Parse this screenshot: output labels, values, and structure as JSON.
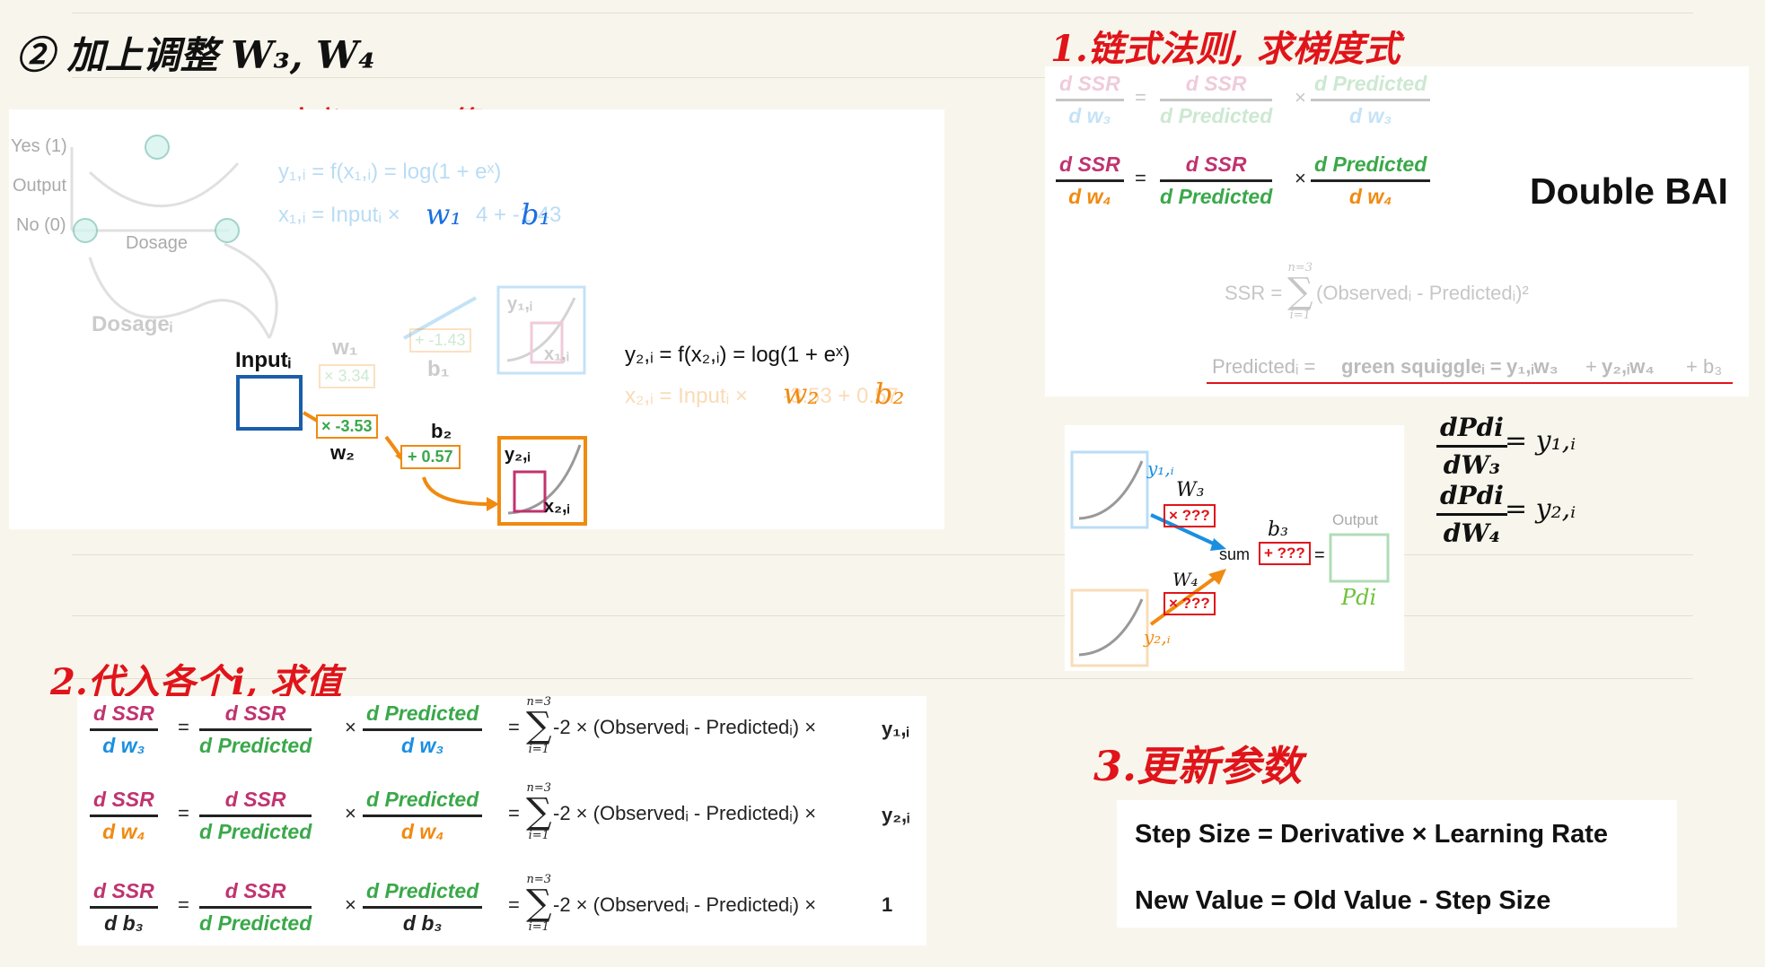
{
  "notes": {
    "main_title": "② 加上调整 W₃, W₄",
    "step0": "0.定义x₁,ᵢ、y₁,ᵢ等",
    "step1": "1.链式法则, 求梯度式",
    "step2": "2.代入各个i, 求值",
    "step3": "3.更新参数",
    "dpdw3_num": "dPdi",
    "dpdw3_den": "dW₃",
    "dpdw3_rhs": "= y₁,ᵢ",
    "dpdw4_num": "dPdi",
    "dpdw4_den": "dW₄",
    "dpdw4_rhs": "= y₂,ᵢ"
  },
  "network_card": {
    "yes_label": "Yes (1)",
    "output_label": "Output",
    "no_label": "No (0)",
    "dosage_label": "Dosage",
    "dosage_i_label": "Dosageᵢ",
    "eq_y1": "y₁,ᵢ = f(x₁,ᵢ) = log(1 + eˣ)",
    "eq_x1": "x₁,ᵢ = Inputᵢ ×",
    "eq_x1_tail": "4 + -1.43",
    "hand_w1": "w₁",
    "hand_b1": "b₁",
    "faded_w1": "w₁",
    "faded_w1_val": "× 3.34",
    "faded_b1": "b₁",
    "faded_b1_val": "+ -1.43",
    "faded_y1": "y₁,ᵢ",
    "faded_x1": "x₁,ᵢ",
    "input_label": "Inputᵢ",
    "w2_val": "× -3.53",
    "w2_label": "w₂",
    "b2_label": "b₂",
    "b2_val": "+ 0.57",
    "y2_label": "y₂,ᵢ",
    "x2_label": "x₂,ᵢ",
    "eq_y2": "y₂,ᵢ = f(x₂,ᵢ) = log(1 + eˣ)",
    "eq_x2": "x₂,ᵢ = Inputᵢ ×",
    "eq_x2_tail": "-3.53 + 0.57",
    "hand_w2": "w₂",
    "hand_b2": "b₂"
  },
  "chain_card": {
    "r1_lhs_num": "d SSR",
    "r1_lhs_den": "d w₃",
    "r1_mid_num": "d SSR",
    "r1_mid_den": "d Predicted",
    "r1_rhs_num": "d Predicted",
    "r1_rhs_den": "d w₃",
    "r2_lhs_num": "d SSR",
    "r2_lhs_den": "d w₄",
    "r2_mid_num": "d SSR",
    "r2_mid_den": "d Predicted",
    "r2_rhs_num": "d Predicted",
    "r2_rhs_den": "d w₄",
    "eq": "=",
    "times": "×",
    "double_bam": "Double BAI",
    "ssr_lhs": "SSR =",
    "ssr_rhs": "(Observedᵢ - Predictedᵢ)²",
    "sum_top": "n=3",
    "sum_bot": "i=1",
    "pred_lhs": "Predictedᵢ =",
    "pred_mid": "green squiggleᵢ =",
    "pred_y1w3": "y₁,ᵢw₃",
    "pred_plus1": "+",
    "pred_y2w4": "y₂,ᵢw₄",
    "pred_plus2": "+ b₃"
  },
  "output_card": {
    "w3_hand": "W₃",
    "w4_hand": "W₄",
    "y1_hand": "y₁,ᵢ",
    "y2_hand": "y₂,ᵢ",
    "b3_hand": "b₃",
    "w3_box": "× ???",
    "w4_box": "× ???",
    "b3_box": "+ ???",
    "sum_label": "sum",
    "eq": "=",
    "output_label": "Output",
    "pdi_hand": "Pdi"
  },
  "derivatives_card": {
    "rows": [
      {
        "lhs_num": "d SSR",
        "lhs_den": "d w₃",
        "mid_num": "d SSR",
        "mid_den": "d Predicted",
        "rhs_num": "d Predicted",
        "rhs_den": "d w₃",
        "expr": "-2 × (Observedᵢ - Predictedᵢ) ×",
        "tail": "y₁,ᵢ"
      },
      {
        "lhs_num": "d SSR",
        "lhs_den": "d w₄",
        "mid_num": "d SSR",
        "mid_den": "d Predicted",
        "rhs_num": "d Predicted",
        "rhs_den": "d w₄",
        "expr": "-2 × (Observedᵢ - Predictedᵢ) ×",
        "tail": "y₂,ᵢ"
      },
      {
        "lhs_num": "d SSR",
        "lhs_den": "d b₃",
        "mid_num": "d SSR",
        "mid_den": "d Predicted",
        "rhs_num": "d Predicted",
        "rhs_den": "d b₃",
        "expr": "-2 × (Observedᵢ - Predictedᵢ) ×",
        "tail": "1"
      }
    ],
    "eq": "=",
    "times": "×",
    "sum_top": "n=3",
    "sum_bot": "i=1"
  },
  "update_card": {
    "line1": "Step Size = Derivative × Learning Rate",
    "line2": "New Value = Old Value - Step Size"
  }
}
